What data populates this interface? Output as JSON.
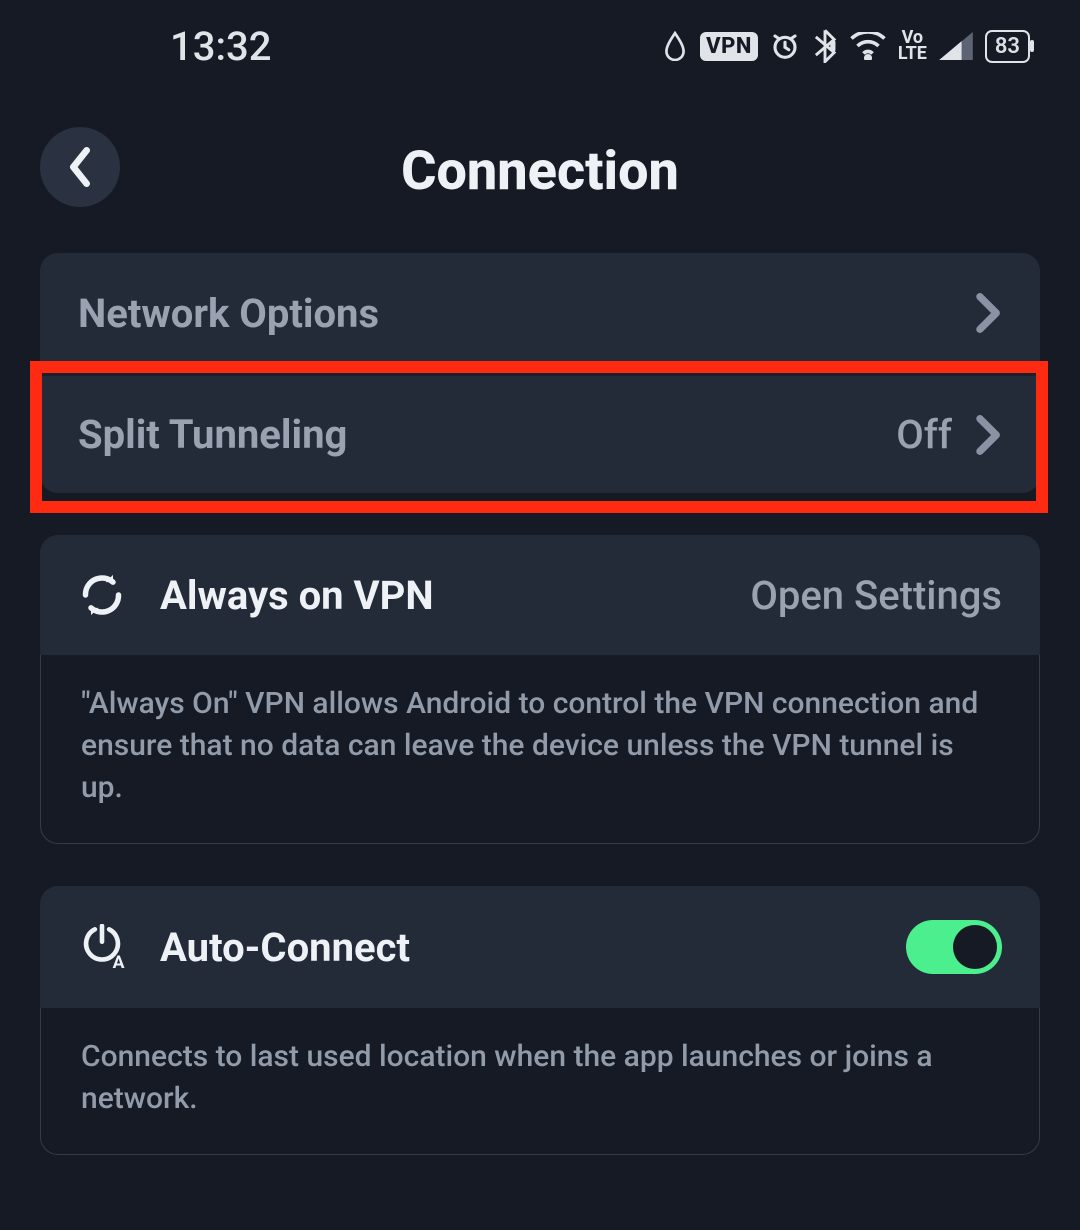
{
  "status": {
    "time": "13:32",
    "battery": "83",
    "icons": [
      "drop",
      "vpn",
      "alarm",
      "bluetooth",
      "wifi",
      "volte",
      "signal",
      "battery"
    ]
  },
  "header": {
    "title": "Connection"
  },
  "group1": {
    "network_options": {
      "label": "Network Options"
    },
    "split_tunneling": {
      "label": "Split Tunneling",
      "value": "Off",
      "highlighted": true
    }
  },
  "always_on": {
    "label": "Always on VPN",
    "action": "Open Settings",
    "description": "\"Always On\" VPN allows Android to control the VPN connection and ensure that no data can leave the device unless the VPN tunnel is up."
  },
  "auto_connect": {
    "label": "Auto-Connect",
    "enabled": true,
    "description": "Connects to last used location when the app launches or joins a network."
  }
}
